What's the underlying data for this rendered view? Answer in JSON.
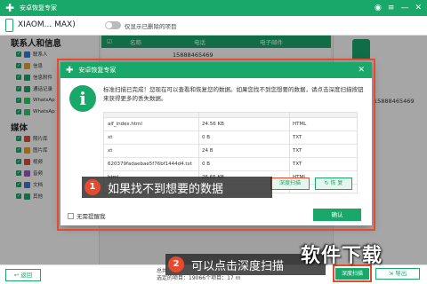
{
  "app": {
    "title": "安卓恢复专家",
    "logo": "✚"
  },
  "window_controls": {
    "wifi": "◉",
    "menu": "≡",
    "minimize": "—",
    "close": "✕"
  },
  "device": {
    "name": "XIAOM... MAX)",
    "toggle_label": "仅显示已删除的项目"
  },
  "sidebar": {
    "contacts_title": "联系人和信息",
    "contacts_items": [
      "联系人",
      "信息",
      "信息附件",
      "通话记录",
      "WhatsAp",
      "WhatsAp"
    ],
    "media_title": "媒体",
    "media_items": [
      "照片库",
      "图片库",
      "视频",
      "音频",
      "文档",
      "其他"
    ],
    "icon_colors": [
      "#3a7bd5",
      "#f0a020",
      "#1aa86a",
      "#1aa86a",
      "#25d366",
      "#25d366",
      "#e84a2d",
      "#f0a020",
      "#e84a2d",
      "#9b59b6",
      "#3a7bd5",
      "#1aa86a"
    ]
  },
  "table": {
    "headers": [
      "名称",
      "电话",
      "电子邮件"
    ],
    "row1": {
      "name": "",
      "phone": "15888465469",
      "email": ""
    }
  },
  "right_pane": {
    "phone": "15888465469"
  },
  "modal": {
    "title": "安卓恢复专家",
    "info_icon": "i",
    "close": "✕",
    "message": "标准扫描已完成！您现在可以查看和恢复您的数据。如果您找不到您想要的数据，请点击深度扫描按钮来获得更多的丢失数据。",
    "files": [
      {
        "name": "alf_index.html",
        "size": "24.56 KB",
        "type": "HTML"
      },
      {
        "name": "xt",
        "size": "0 B",
        "type": "TXT"
      },
      {
        "name": "xt",
        "size": "24 B",
        "type": "TXT"
      },
      {
        "name": "620379fadaebae5f76bf1444d4.txt",
        "size": "0 B",
        "type": "TXT"
      },
      {
        "name": "html",
        "size": "26.65 KB",
        "type": "HTML"
      }
    ],
    "deep_scan_label": "深度扫描",
    "recover_label": "↻ 恢 复",
    "no_remind_label": "无需提醒我",
    "ok_label": "确认"
  },
  "callouts": [
    {
      "num": "1",
      "text": "如果找不到想要的数据"
    },
    {
      "num": "2",
      "text": "可以点击深度扫描"
    }
  ],
  "bottom": {
    "back_label": "↩ 返回",
    "status_line1": "总共",
    "status_line2": "选定的项目：19066个项目：17 m",
    "deep_scan_label": "深度扫描",
    "export_label": "⇲ 导出"
  },
  "watermark": "软件下载",
  "colors": {
    "accent": "#1aa86a",
    "highlight": "#e84a2d"
  }
}
